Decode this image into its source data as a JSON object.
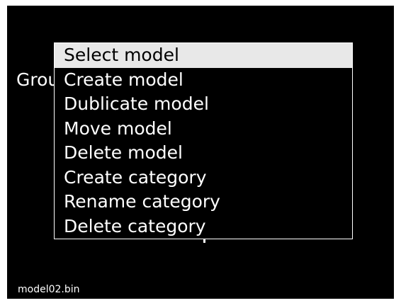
{
  "background_label": "Grou",
  "menu": {
    "items": [
      {
        "label": "Select model",
        "selected": true
      },
      {
        "label": "Create model",
        "selected": false
      },
      {
        "label": "Dublicate model",
        "selected": false
      },
      {
        "label": "Move model",
        "selected": false
      },
      {
        "label": "Delete model",
        "selected": false
      },
      {
        "label": "Create category",
        "selected": false
      },
      {
        "label": "Rename category",
        "selected": false
      },
      {
        "label": "Delete category",
        "selected": false
      }
    ]
  },
  "footer": {
    "filename": "model02.bin"
  },
  "colors": {
    "screen_background": "#000000",
    "text": "#ffffff",
    "selection_background": "#e8e8e8",
    "selection_text": "#000000"
  }
}
